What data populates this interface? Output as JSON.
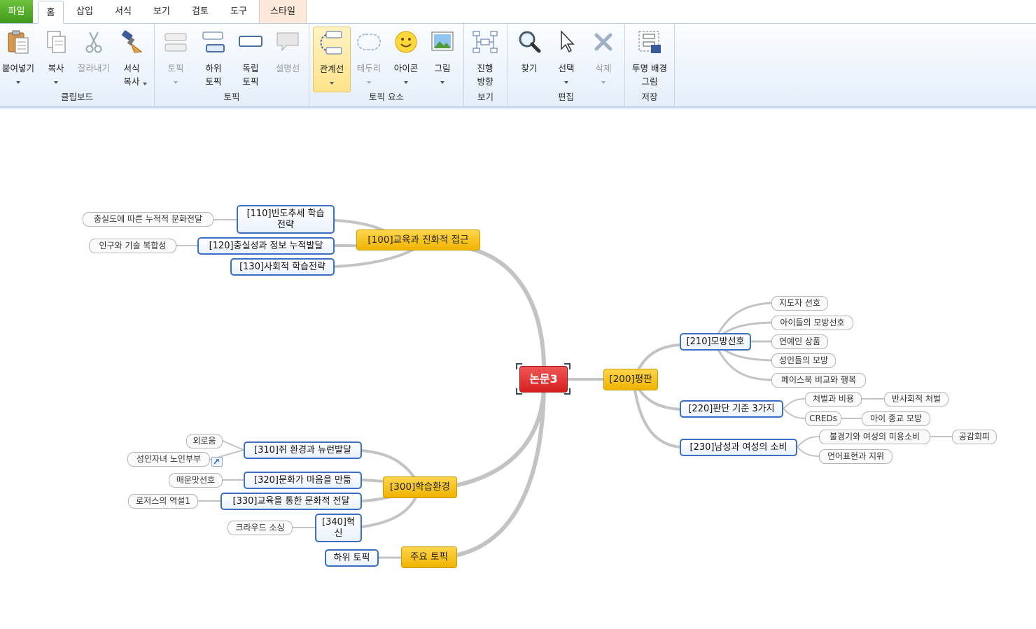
{
  "tabs": {
    "file": "파일",
    "home": "홈",
    "insert": "삽입",
    "format": "서식",
    "view": "보기",
    "review": "검토",
    "tools": "도구",
    "style": "스타일"
  },
  "ribbon": {
    "clipboard": {
      "label": "클립보드",
      "paste": "붙여넣기",
      "copy": "복사",
      "cut": "잘라내기",
      "format_copy": "서식\n복사"
    },
    "topic": {
      "label": "토픽",
      "topic": "토픽",
      "subtopic": "하위\n토픽",
      "floating": "독립\n토픽",
      "callout": "설명선"
    },
    "elements": {
      "label": "토픽 요소",
      "relationship": "관계선",
      "boundary": "테두리",
      "icon": "아이콘",
      "image": "그림"
    },
    "view": {
      "label": "보기",
      "direction": "진행\n방향"
    },
    "edit": {
      "label": "편집",
      "find": "찾기",
      "select": "선택",
      "delete": "삭제"
    },
    "save": {
      "label": "저장",
      "transparent": "투명 배경\n그림"
    }
  },
  "mindmap": {
    "center": "논문3",
    "t100": "[100]교육과 진화적 접근",
    "t110": "[110]빈도추세 학습\n전략",
    "t120": "[120]충실성과 정보 누적발달",
    "t130": "[130]사회적 학습전략",
    "l110": "충실도에 따른 누적적 문화전달",
    "l120": "인구와 기술 복합성",
    "t200": "[200]평판",
    "t210": "[210]모방선호",
    "t220": "[220]판단 기준 3가지",
    "t230": "[230]남성과 여성의 소비",
    "l211": "지도자 선호",
    "l212": "아이들의 모방선호",
    "l213": "연예인 상품",
    "l214": "성인들의 모방",
    "l215": "페이스북 비교와 행복",
    "l221": "처벌과 비용",
    "l221b": "반사회적 처벌",
    "l222": "CREDs",
    "l222b": "아이 종교 모방",
    "l231": "불경기와 여성의 미용소비",
    "l231b": "공감회피",
    "l232": "언어표현과 지위",
    "t300": "[300]학습환경",
    "t310": "[310]쥐 환경과 뉴런발달",
    "t320": "[320]문화가 마음을 만듦",
    "t330": "[330]교육을 통한 문화적 전달",
    "t340": "[340]혁\n신",
    "l310a": "외로움",
    "l310b": "성인자녀 노인부부",
    "l320": "매운맛선호",
    "l330": "로저스의 역설1",
    "l340": "크라우드 소싱",
    "main_topic": "주요 토픽",
    "sub_topic": "하위 토픽"
  }
}
